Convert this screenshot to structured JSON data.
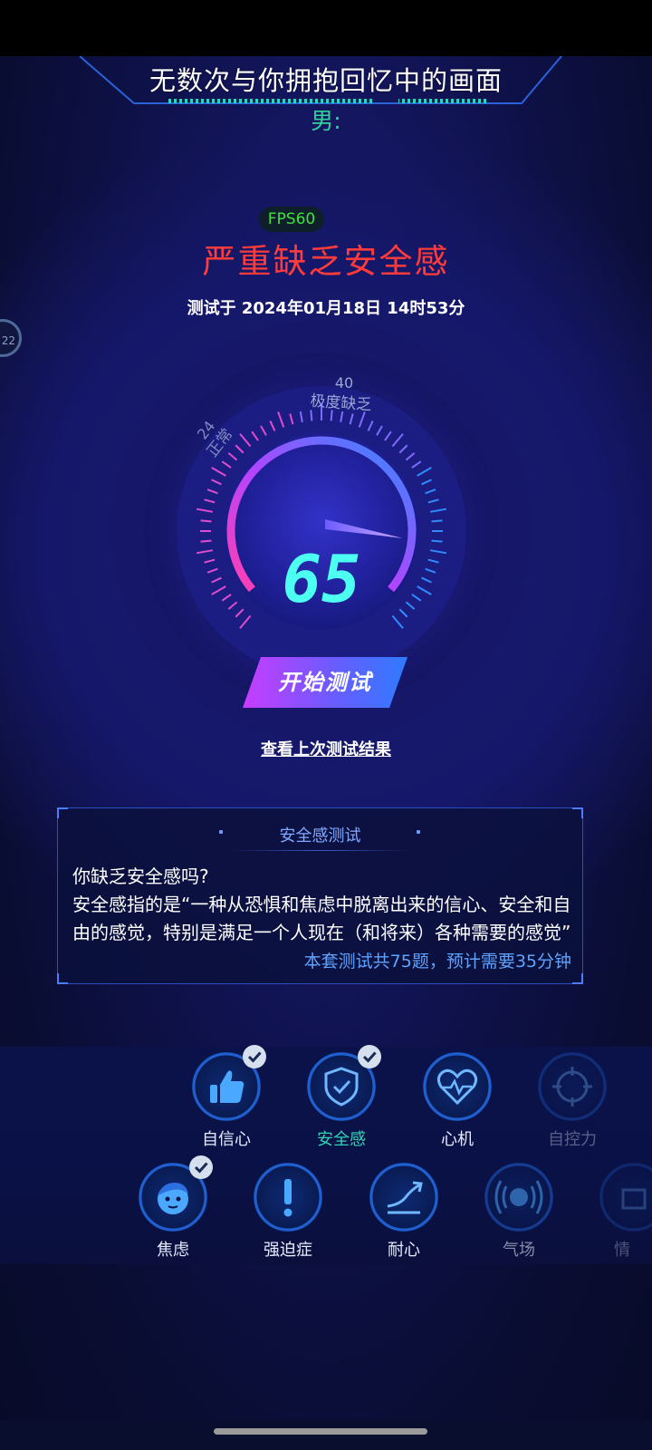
{
  "header": {
    "title": "无数次与你拥抱回忆中的画面",
    "gender": "男:"
  },
  "fps_badge": "FPS60",
  "result": {
    "verdict": "严重缺乏安全感",
    "tested_at": "测试于 2024年01月18日 14时53分"
  },
  "side_bubble": "22",
  "gauge": {
    "score": "65",
    "score_value": 65,
    "mark_normal_value": "24",
    "mark_normal_label": "正常",
    "mark_severe_value": "40",
    "mark_severe_label": "极度缺乏"
  },
  "actions": {
    "start_label": "开始测试",
    "last_result_label": "查看上次测试结果"
  },
  "info": {
    "title": "安全感测试",
    "question": "你缺乏安全感吗?",
    "description": "安全感指的是“一种从恐惧和焦虑中脱离出来的信心、安全和自由的感觉，特别是满足一个人现在（和将来）各种需要的感觉”",
    "note": "本套测试共75题，预计需要35分钟"
  },
  "categories_row1": [
    {
      "label": "自信心",
      "icon": "thumbs-up-icon",
      "checked": true,
      "active": false
    },
    {
      "label": "安全感",
      "icon": "shield-check-icon",
      "checked": true,
      "active": true
    },
    {
      "label": "心机",
      "icon": "heart-pulse-icon",
      "checked": false,
      "active": false
    },
    {
      "label": "自控力",
      "icon": "target-icon",
      "checked": false,
      "active": false
    }
  ],
  "categories_row2": [
    {
      "label": "焦虑",
      "icon": "face-icon",
      "checked": true
    },
    {
      "label": "强迫症",
      "icon": "exclamation-icon",
      "checked": false
    },
    {
      "label": "耐心",
      "icon": "trend-arrow-icon",
      "checked": false
    },
    {
      "label": "气场",
      "icon": "broadcast-icon",
      "checked": false
    },
    {
      "label": "情",
      "icon": "partial-icon",
      "checked": false
    }
  ],
  "colors": {
    "verdict": "#ff3b3b",
    "gender": "#2fd39b",
    "score": "#4dfff0",
    "active_label": "#2fd3b3",
    "accent_blue": "#5fa3ff"
  }
}
